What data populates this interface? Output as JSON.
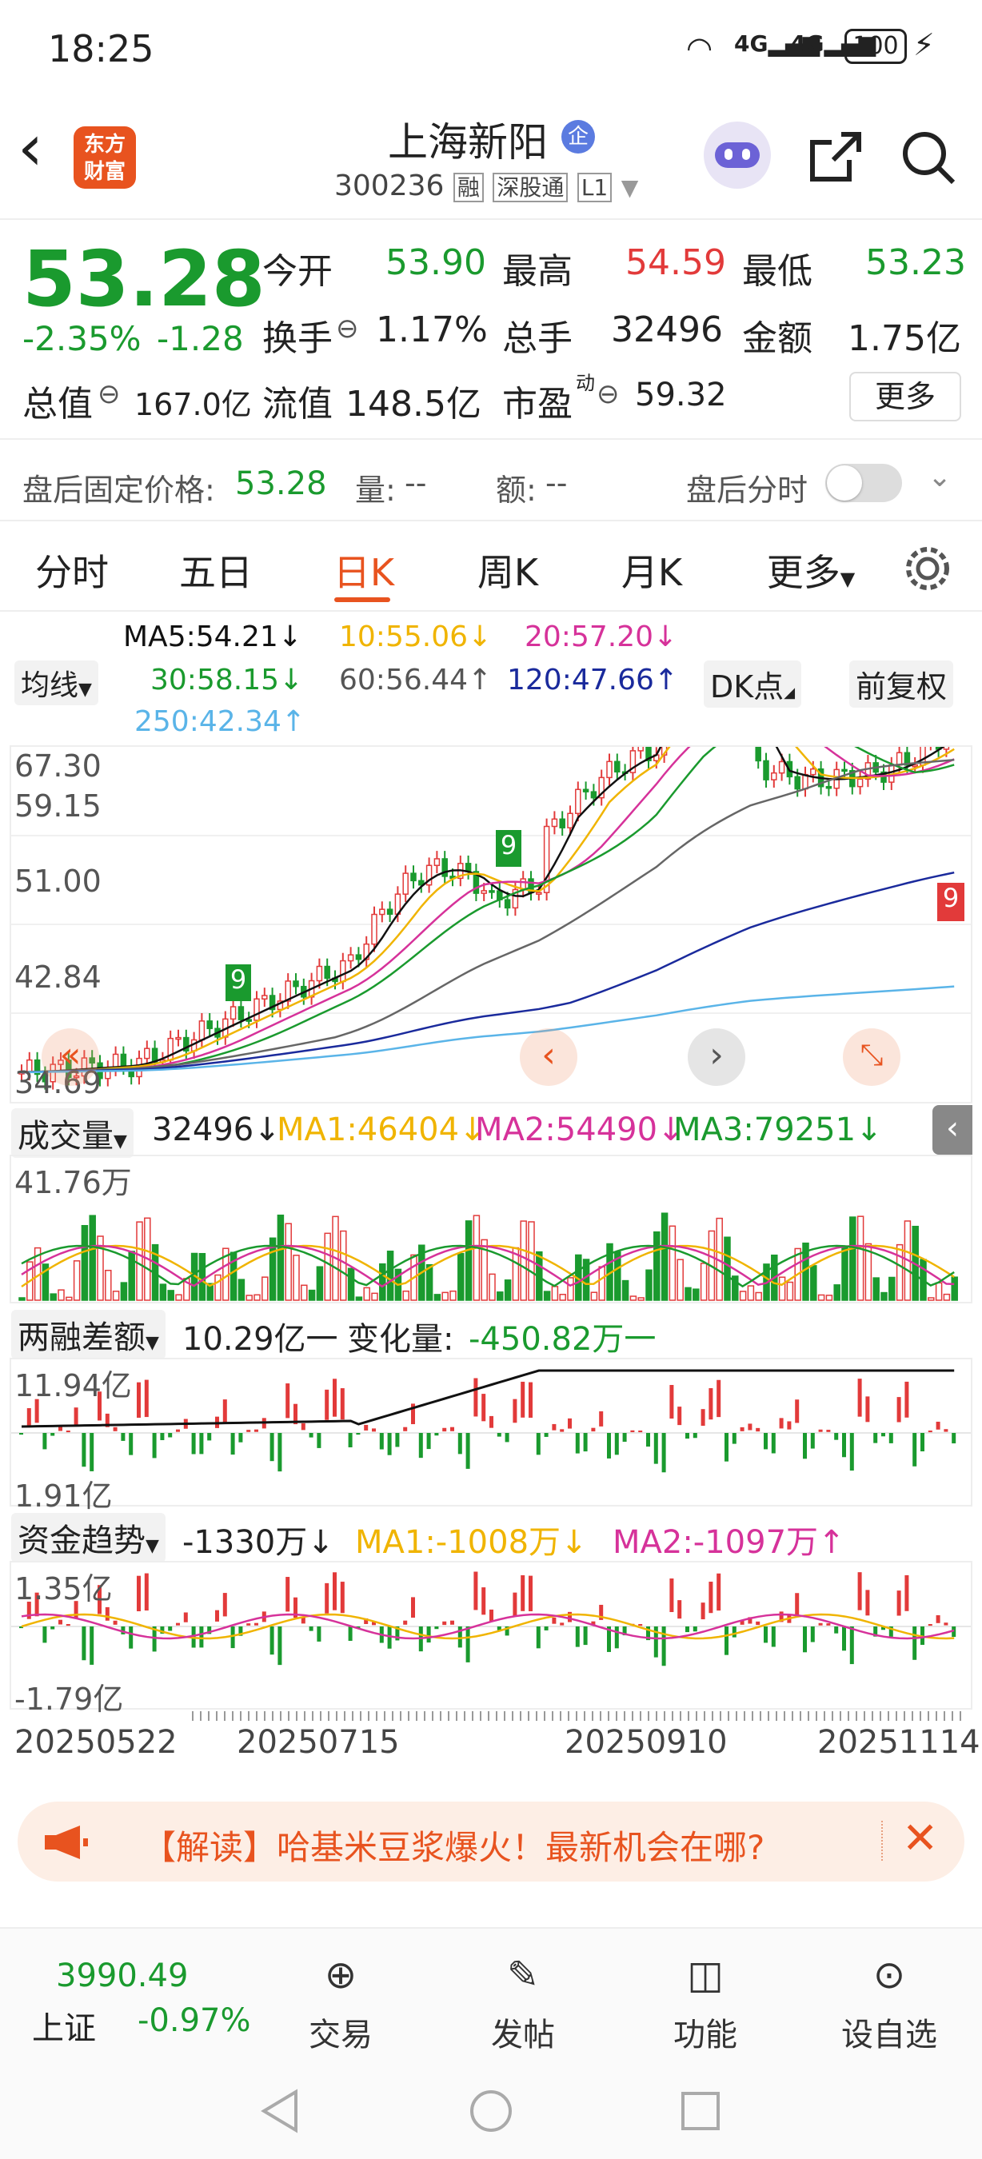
{
  "status_bar": {
    "time": "18:25",
    "battery": "100",
    "signal_1": "4G",
    "signal_2": "4G"
  },
  "header": {
    "logo_text_1": "东方",
    "logo_text_2": "财富",
    "stock_name": "上海新阳",
    "badge": "企",
    "stock_code": "300236",
    "tag_rong": "融",
    "tag_sgt": "深股通",
    "tag_l1": "L1"
  },
  "quote": {
    "price": "53.28",
    "change_pct": "-2.35%",
    "change": "-1.28",
    "open_label": "今开",
    "open": "53.90",
    "high_label": "最高",
    "high": "54.59",
    "low_label": "最低",
    "low": "53.23",
    "turnover_label": "换手",
    "turnover": "1.17%",
    "volume_label": "总手",
    "volume": "32496",
    "amount_label": "金额",
    "amount": "1.75亿",
    "mktcap_label": "总值",
    "mktcap": "167.0亿",
    "float_label": "流值",
    "float": "148.5亿",
    "pe_label": "市盈",
    "pe_sup": "动",
    "pe": "59.32",
    "more_button": "更多"
  },
  "after_hours": {
    "label": "盘后固定价格:",
    "price": "53.28",
    "vol_label": "量:",
    "vol": "--",
    "amt_label": "额:",
    "amt": "--",
    "toggle_label": "盘后分时",
    "toggle_on": false
  },
  "tabs": [
    "分时",
    "五日",
    "日K",
    "周K",
    "月K",
    "更多"
  ],
  "active_tab": 2,
  "ma_legend": {
    "selector": "均线",
    "ma5": "MA5:54.21↓",
    "ma10": "10:55.06↓",
    "ma20": "20:57.20↓",
    "ma30": "30:58.15↓",
    "ma60": "60:56.44↑",
    "ma120": "120:47.66↑",
    "ma250": "250:42.34↑",
    "dk_button": "DK点",
    "fq_button": "前复权"
  },
  "kline": {
    "y_labels": [
      "67.30",
      "59.15",
      "51.00",
      "42.84",
      "34.69"
    ],
    "signal_markers": [
      "9",
      "9",
      "9"
    ]
  },
  "volume_panel": {
    "selector": "成交量",
    "value": "32496↓",
    "ma1": "MA1:46404↓",
    "ma2": "MA2:54490↓",
    "ma3": "MA3:79251↓",
    "ymax": "41.76万"
  },
  "margin_panel": {
    "selector": "两融差额",
    "value": "10.29亿一",
    "change_label": "变化量:",
    "change": "-450.82万一",
    "ymax": "11.94亿",
    "ymin": "1.91亿"
  },
  "fund_panel": {
    "selector": "资金趋势",
    "value": "-1330万↓",
    "ma1": "MA1:-1008万↓",
    "ma2": "MA2:-1097万↑",
    "ymax": "1.35亿",
    "ymin": "-1.79亿"
  },
  "dates": [
    "20250522",
    "20250715",
    "20250910",
    "20251114"
  ],
  "news": {
    "text": "【解读】哈基米豆浆爆火！最新机会在哪?"
  },
  "bottom_nav": {
    "index_value": "3990.49",
    "index_name": "上证",
    "index_change": "-0.97%",
    "items": [
      "交易",
      "发帖",
      "功能",
      "设自选"
    ]
  },
  "colors": {
    "up": "#e23a3a",
    "down": "#1a9a2e",
    "accent": "#e8531f",
    "ma5": "#111111",
    "ma10": "#f0b400",
    "ma20": "#d6329a",
    "ma30": "#1a9a2e",
    "ma60": "#666666",
    "ma120": "#1a2a9c",
    "ma250": "#5ab4e8"
  }
}
